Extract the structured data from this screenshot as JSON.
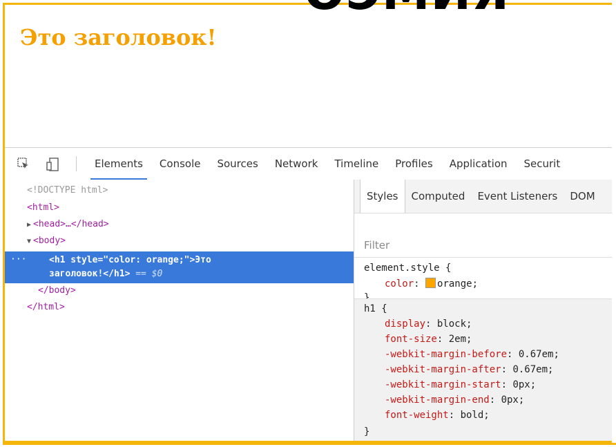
{
  "slide": {
    "title_fragment": "ОЭМИЯ"
  },
  "page": {
    "heading": "Это заголовок!"
  },
  "toolbar": {
    "inspect_icon": "inspect-element-icon",
    "device_icon": "device-mode-icon",
    "tabs": [
      "Elements",
      "Console",
      "Sources",
      "Network",
      "Timeline",
      "Profiles",
      "Application",
      "Securit"
    ]
  },
  "dom": {
    "doctype": "<!DOCTYPE html>",
    "html_open": "<html>",
    "head": "<head>…</head>",
    "body_open": "<body>",
    "selected_dots": "···",
    "selected_line1_open": "<h1 style=\"color: orange;\">Это",
    "selected_line2": "заголовок!</h1>",
    "selected_marker": "== $0",
    "body_close": "</body>",
    "html_close": "</html>"
  },
  "styles_panel": {
    "tabs": [
      "Styles",
      "Computed",
      "Event Listeners",
      "DOM"
    ],
    "filter_placeholder": "Filter",
    "element_style": {
      "selector": "element.style {",
      "property": "color",
      "value": "orange;",
      "swatch_color": "#ffa500",
      "close": "}"
    },
    "h1_rule": {
      "selector": "h1 {",
      "declarations": [
        {
          "property": "display",
          "value": "block;"
        },
        {
          "property": "font-size",
          "value": "2em;"
        },
        {
          "property": "-webkit-margin-before",
          "value": "0.67em;"
        },
        {
          "property": "-webkit-margin-after",
          "value": "0.67em;"
        },
        {
          "property": "-webkit-margin-start",
          "value": "0px;"
        },
        {
          "property": "-webkit-margin-end",
          "value": "0px;"
        },
        {
          "property": "font-weight",
          "value": "bold;"
        }
      ],
      "close": "}"
    }
  },
  "colors": {
    "frame": "#f5b50a",
    "heading": "#f5a000",
    "selection": "#3879d9"
  }
}
